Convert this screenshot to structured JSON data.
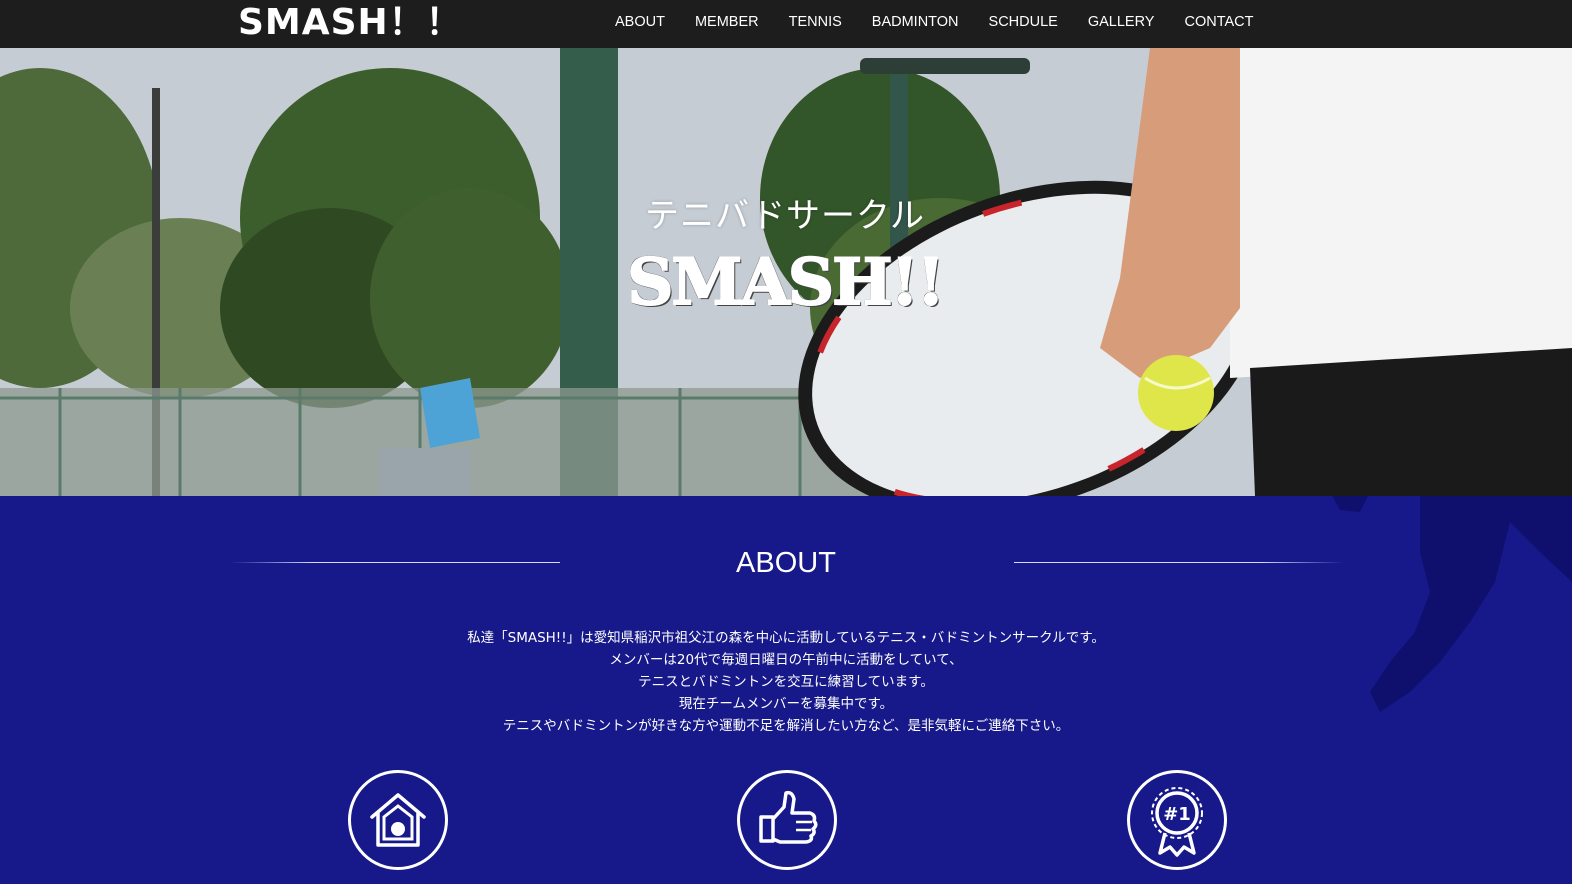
{
  "header": {
    "logo": "SMASH！！",
    "nav": [
      "ABOUT",
      "MEMBER",
      "TENNIS",
      "BADMINTON",
      "SCHDULE",
      "GALLERY",
      "CONTACT"
    ]
  },
  "hero": {
    "subtitle": "テニバドサークル",
    "title": "SMASH!!"
  },
  "about": {
    "title": "ABOUT",
    "lines": [
      "私達「SMASH!!」は愛知県稲沢市祖父江の森を中心に活動しているテニス・バドミントンサークルです。",
      "メンバーは20代で毎週日曜日の午前中に活動をしていて、",
      "テニスとバドミントンを交互に練習しています。",
      "現在チームメンバーを募集中です。",
      "テニスやバドミントンが好きな方や運動不足を解消したい方など、是非気軽にご連絡下さい。"
    ],
    "icons": [
      "home-icon",
      "thumbs-up-icon",
      "number-one-badge-icon"
    ],
    "badge_text": "#1"
  },
  "colors": {
    "header_bg": "#1d1d1d",
    "about_bg": "#17188a",
    "text": "#ffffff"
  }
}
